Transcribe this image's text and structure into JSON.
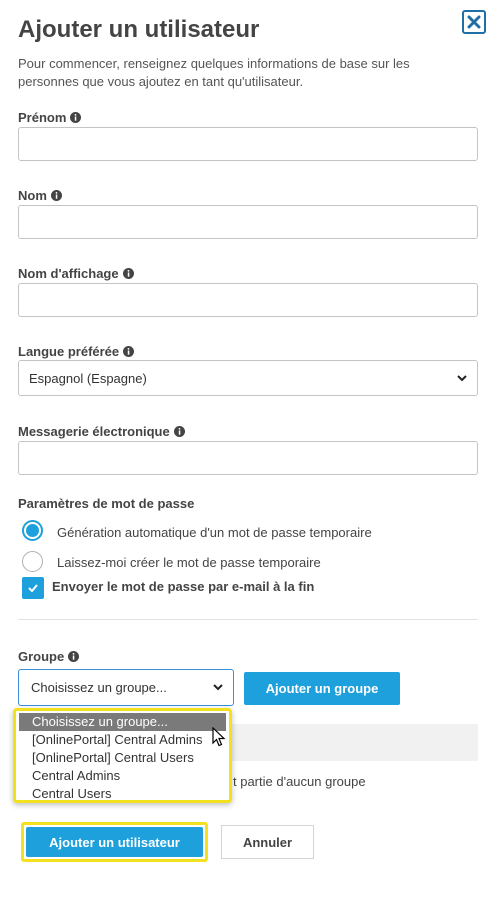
{
  "header": {
    "title": "Ajouter un utilisateur",
    "intro": "Pour commencer, renseignez quelques informations de base sur les personnes que vous ajoutez en tant qu'utilisateur."
  },
  "fields": {
    "first_name": {
      "label": "Prénom",
      "value": ""
    },
    "last_name": {
      "label": "Nom",
      "value": ""
    },
    "display_name": {
      "label": "Nom d'affichage",
      "value": ""
    },
    "language": {
      "label": "Langue préférée",
      "selected": "Espagnol (Espagne)"
    },
    "email": {
      "label": "Messagerie électronique",
      "value": ""
    }
  },
  "password": {
    "title": "Paramètres de mot de passe",
    "option_auto": "Génération automatique d'un mot de passe temporaire",
    "option_manual": "Laissez-moi créer le mot de passe temporaire",
    "send_email": "Envoyer le mot de passe par e-mail à la fin"
  },
  "group": {
    "label": "Groupe",
    "selected": "Choisissez un groupe...",
    "add_button": "Ajouter un groupe",
    "options": [
      "Choisissez un groupe...",
      "[OnlinePortal] Central Admins",
      "[OnlinePortal] Central Users",
      "Central Admins",
      "Central Users"
    ],
    "partial_text": "t partie d'aucun groupe"
  },
  "footer": {
    "submit": "Ajouter un utilisateur",
    "cancel": "Annuler"
  },
  "colors": {
    "accent": "#1ea0dc",
    "highlight": "#f3e11e",
    "close_border": "#1f6fa6"
  },
  "icons": [
    "close-icon",
    "info-icon",
    "chevron-down-icon",
    "check-icon",
    "mouse-cursor-icon"
  ]
}
